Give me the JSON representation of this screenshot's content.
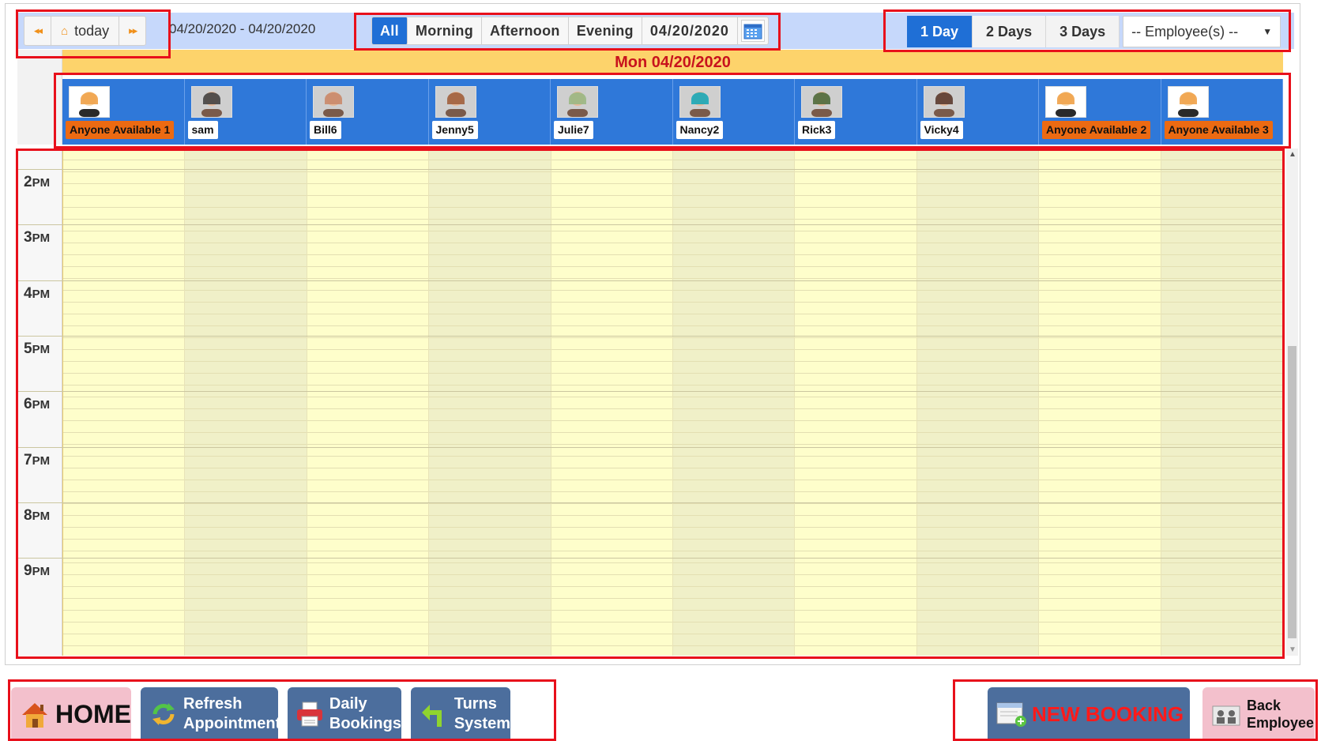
{
  "toolbar": {
    "prev_icon": "double-left-arrow",
    "today_label": "today",
    "next_icon": "double-right-arrow",
    "date_range": "04/20/2020 - 04/20/2020",
    "filters": [
      "All",
      "Morning",
      "Afternoon",
      "Evening"
    ],
    "active_filter": "All",
    "date_value": "04/20/2020",
    "day_views": [
      "1 Day",
      "2 Days",
      "3 Days"
    ],
    "active_day_view": "1 Day",
    "employee_select": "-- Employee(s) --"
  },
  "day_header": "Mon 04/20/2020",
  "employees": [
    {
      "name": "Anyone Available 1",
      "highlight": true
    },
    {
      "name": "sam",
      "highlight": false
    },
    {
      "name": "Bill6",
      "highlight": false
    },
    {
      "name": "Jenny5",
      "highlight": false
    },
    {
      "name": "Julie7",
      "highlight": false
    },
    {
      "name": "Nancy2",
      "highlight": false
    },
    {
      "name": "Rick3",
      "highlight": false
    },
    {
      "name": "Vicky4",
      "highlight": false
    },
    {
      "name": "Anyone Available 2",
      "highlight": true
    },
    {
      "name": "Anyone Available 3",
      "highlight": true
    }
  ],
  "time_slots": [
    {
      "hour": "2",
      "ampm": "PM"
    },
    {
      "hour": "3",
      "ampm": "PM"
    },
    {
      "hour": "4",
      "ampm": "PM"
    },
    {
      "hour": "5",
      "ampm": "PM"
    },
    {
      "hour": "6",
      "ampm": "PM"
    },
    {
      "hour": "7",
      "ampm": "PM"
    },
    {
      "hour": "8",
      "ampm": "PM"
    },
    {
      "hour": "9",
      "ampm": "PM"
    }
  ],
  "footer": {
    "home": "HOME",
    "refresh": [
      "Refresh",
      "Appointment"
    ],
    "daily": [
      "Daily",
      "Bookings"
    ],
    "turns": [
      "Turns",
      "System"
    ],
    "new_booking": "NEW BOOKING",
    "back": [
      "Back",
      "Employee"
    ]
  },
  "colors": {
    "accent_blue": "#1f6fd6",
    "header_yellow": "#fdd36b",
    "highlight_orange": "#ec6a12",
    "annotation_red": "#e8101b"
  }
}
